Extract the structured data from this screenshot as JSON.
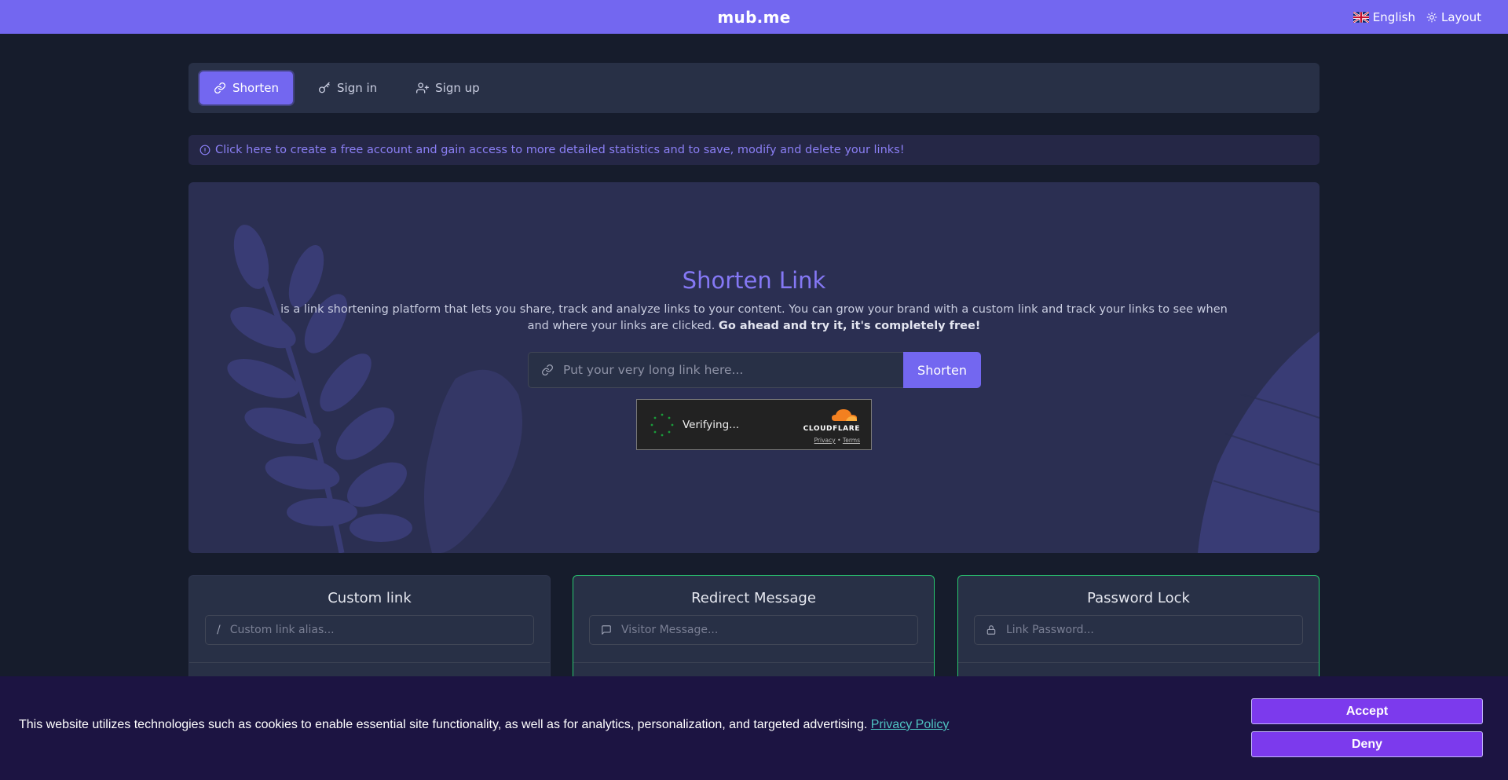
{
  "header": {
    "brand": "mub.me",
    "language": "English",
    "layout": "Layout"
  },
  "nav": {
    "tabs": [
      {
        "label": "Shorten",
        "icon": "link-icon",
        "active": true
      },
      {
        "label": "Sign in",
        "icon": "key-icon",
        "active": false
      },
      {
        "label": "Sign up",
        "icon": "user-plus-icon",
        "active": false
      }
    ]
  },
  "alert": {
    "text": "Click here to create a free account and gain access to more detailed statistics and to save, modify and delete your links!"
  },
  "hero": {
    "title": "Shorten Link",
    "description": "is a link shortening platform that lets you share, track and analyze links to your content. You can grow your brand with a custom link and track your links to see when and where your links are clicked.",
    "description_bold": "Go ahead and try it, it's completely free!",
    "input_placeholder": "Put your very long link here...",
    "button_label": "Shorten"
  },
  "captcha": {
    "status": "Verifying...",
    "provider": "CLOUDFLARE",
    "privacy": "Privacy",
    "separator": "•",
    "terms": "Terms"
  },
  "options": [
    {
      "title": "Custom link",
      "placeholder": "Custom link alias...",
      "prefix": "/",
      "icon": "slash-icon"
    },
    {
      "title": "Redirect Message",
      "placeholder": "Visitor Message...",
      "icon": "message-icon"
    },
    {
      "title": "Password Lock",
      "placeholder": "Link Password...",
      "icon": "lock-icon"
    }
  ],
  "cookie": {
    "text": "This website utilizes technologies such as cookies to enable essential site functionality, as well as for analytics, personalization, and targeted advertising.",
    "policy_link": "Privacy Policy",
    "accept": "Accept",
    "deny": "Deny"
  },
  "colors": {
    "accent": "#7367f0",
    "background": "#161c2c",
    "card": "#283046",
    "success_border": "#28c76f",
    "cookie_button": "#7c3aed"
  }
}
